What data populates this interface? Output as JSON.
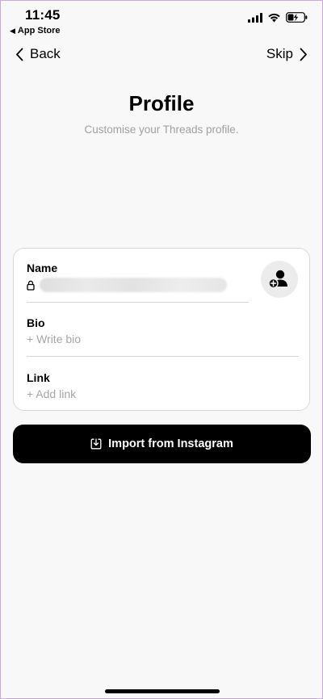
{
  "status_bar": {
    "time": "11:45",
    "back_app": "App Store",
    "back_app_icon": "back-triangle-icon"
  },
  "nav": {
    "back_label": "Back",
    "skip_label": "Skip"
  },
  "header": {
    "title": "Profile",
    "subtitle": "Customise your Threads profile."
  },
  "form": {
    "name_label": "Name",
    "bio_label": "Bio",
    "bio_placeholder": "+ Write bio",
    "link_label": "Link",
    "link_placeholder": "+ Add link"
  },
  "import_button": {
    "label": "Import from Instagram",
    "icon": "download-icon"
  },
  "colors": {
    "background": "#f8f8f8",
    "button": "#000000",
    "placeholder": "#a5a5a5"
  }
}
